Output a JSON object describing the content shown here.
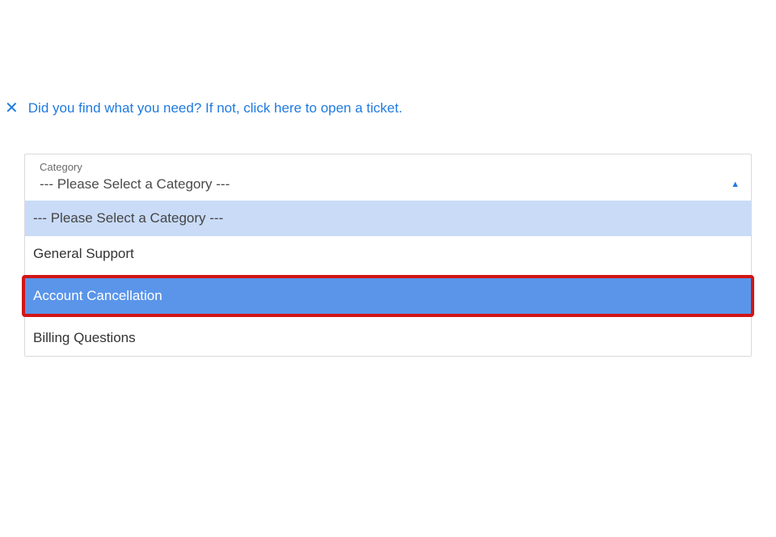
{
  "banner": {
    "close_symbol": "✕",
    "message": "Did you find what you need? If not, click here to open a ticket."
  },
  "category": {
    "label": "Category",
    "selected": "--- Please Select a Category ---",
    "caret": "▲",
    "options": {
      "placeholder": "--- Please Select a Category ---",
      "general": "General Support",
      "cancellation": "Account Cancellation",
      "billing": "Billing Questions"
    }
  }
}
